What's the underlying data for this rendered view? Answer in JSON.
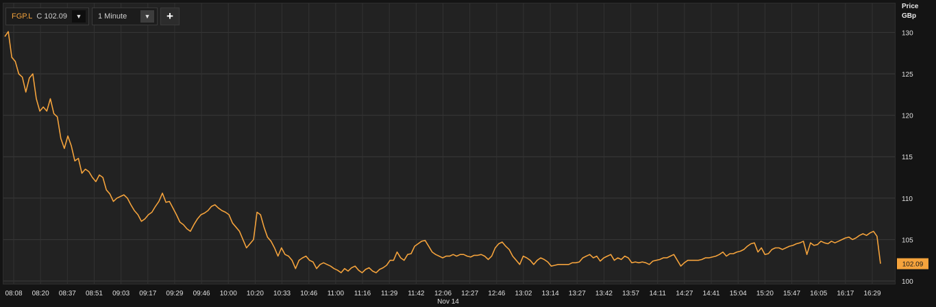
{
  "toolbar": {
    "symbol": "FGP.L",
    "close_label": "C 102.09",
    "interval": "1 Minute",
    "dropdown_icon": "caret-down-icon",
    "add_icon": "plus-icon"
  },
  "axis": {
    "title_line1": "Price",
    "title_line2": "GBp"
  },
  "colors": {
    "line": "#f5a33c",
    "background": "#222222",
    "grid": "#3a3a3a",
    "badge": "#f5a33c"
  },
  "chart_data": {
    "type": "line",
    "title": "",
    "xlabel": "Nov 14",
    "ylabel": "Price GBp",
    "ylim": [
      99.5,
      131
    ],
    "yticks": [
      100,
      105,
      110,
      115,
      120,
      125,
      130
    ],
    "x_tick_labels": [
      "08:08",
      "08:20",
      "08:37",
      "08:51",
      "09:03",
      "09:17",
      "09:29",
      "09:46",
      "10:00",
      "10:20",
      "10:33",
      "10:46",
      "11:00",
      "11:16",
      "11:29",
      "11:42",
      "12:06",
      "12:27",
      "12:46",
      "13:02",
      "13:14",
      "13:27",
      "13:42",
      "13:57",
      "14:11",
      "14:27",
      "14:41",
      "15:04",
      "15:20",
      "15:47",
      "16:05",
      "16:17",
      "16:29"
    ],
    "last_value_label": "102.09",
    "grid": true,
    "series": [
      {
        "values": [
          129.5,
          130.1,
          127.0,
          126.5,
          125.0,
          124.6,
          122.8,
          124.5,
          125.0,
          122.0,
          120.5,
          121.0,
          120.5,
          122.0,
          120.2,
          119.8,
          117.2,
          116.0,
          117.5,
          116.3,
          114.5,
          114.8,
          113.0,
          113.5,
          113.2,
          112.5,
          112.0,
          112.8,
          112.5,
          111.0,
          110.5,
          109.6,
          110.0,
          110.2,
          110.4,
          110.0,
          109.2,
          108.5,
          108.0,
          107.2,
          107.5,
          108.0,
          108.3,
          109.0,
          109.6,
          110.6,
          109.5,
          109.6,
          108.8,
          108.0,
          107.1,
          106.8,
          106.3,
          106.0,
          106.8,
          107.5,
          108.0,
          108.2,
          108.5,
          109.0,
          109.2,
          108.8,
          108.5,
          108.3,
          108.0,
          107.0,
          106.5,
          106.0,
          105.0,
          104.0,
          104.5,
          105.0,
          108.3,
          108.0,
          106.5,
          105.3,
          104.8,
          104.0,
          103.0,
          104.0,
          103.2,
          103.0,
          102.5,
          101.5,
          102.5,
          102.8,
          103.0,
          102.5,
          102.3,
          101.5,
          102.0,
          102.2,
          102.0,
          101.8,
          101.5,
          101.3,
          101.0,
          101.5,
          101.2,
          101.6,
          101.8,
          101.3,
          101.0,
          101.4,
          101.6,
          101.2,
          101.0,
          101.4,
          101.6,
          101.9,
          102.5,
          102.5,
          103.5,
          102.8,
          102.5,
          103.2,
          103.3,
          104.2,
          104.5,
          104.8,
          104.9,
          104.2,
          103.5,
          103.2,
          103.0,
          102.8,
          103.0,
          103.0,
          103.2,
          103.0,
          103.2,
          103.2,
          103.0,
          102.9,
          103.1,
          103.1,
          103.2,
          103.0,
          102.6,
          103.0,
          104.0,
          104.5,
          104.7,
          104.2,
          103.8,
          103.0,
          102.5,
          102.0,
          103.0,
          102.8,
          102.5,
          102.0,
          102.5,
          102.8,
          102.6,
          102.3,
          101.8,
          101.9,
          102.0,
          102.0,
          102.0,
          102.0,
          102.2,
          102.2,
          102.3,
          102.8,
          103.0,
          103.2,
          102.8,
          103.0,
          102.4,
          102.8,
          103.0,
          103.2,
          102.5,
          102.8,
          102.6,
          103.0,
          102.8,
          102.2,
          102.3,
          102.2,
          102.3,
          102.2,
          102.0,
          102.4,
          102.5,
          102.6,
          102.8,
          102.8,
          103.0,
          103.2,
          102.5,
          101.8,
          102.2,
          102.5,
          102.5,
          102.5,
          102.5,
          102.6,
          102.8,
          102.8,
          102.9,
          103.0,
          103.2,
          103.5,
          103.0,
          103.3,
          103.3,
          103.5,
          103.6,
          103.8,
          104.2,
          104.5,
          104.6,
          103.5,
          104.0,
          103.2,
          103.3,
          103.8,
          104.0,
          104.0,
          103.8,
          104.0,
          104.2,
          104.3,
          104.5,
          104.6,
          104.8,
          103.2,
          104.6,
          104.3,
          104.4,
          104.8,
          104.6,
          104.5,
          104.8,
          104.6,
          104.8,
          105.0,
          105.2,
          105.3,
          105.0,
          105.2,
          105.5,
          105.7,
          105.5,
          105.8,
          106.0,
          105.4,
          102.09
        ]
      }
    ]
  }
}
